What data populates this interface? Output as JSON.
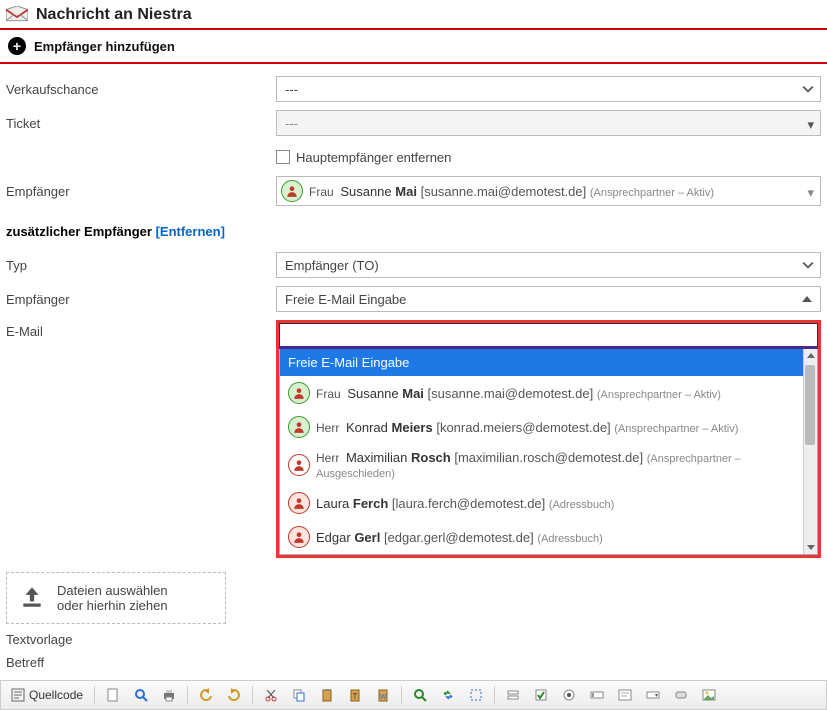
{
  "header": {
    "title": "Nachricht an Niestra"
  },
  "addbar": {
    "label": "Empfänger hinzufügen"
  },
  "labels": {
    "opportunity": "Verkaufschance",
    "ticket": "Ticket",
    "remove_main": "Hauptempfänger entfernen",
    "recipient": "Empfänger",
    "additional": "zusätzlicher Empfänger",
    "remove_link": "[Entfernen]",
    "type": "Typ",
    "recipient2": "Empfänger",
    "email": "E-Mail",
    "template": "Textvorlage",
    "subject": "Betreff"
  },
  "selects": {
    "opportunity": "---",
    "ticket": "---",
    "type": "Empfänger (TO)",
    "freemail": "Freie E-Mail Eingabe"
  },
  "main_recipient": {
    "salutation": "Frau",
    "first": "Susanne",
    "last": "Mai",
    "email": "susanne.mai@demotest.de",
    "meta": "(Ansprechpartner – Aktiv)",
    "icon": "green"
  },
  "email_input": "",
  "dropdown": {
    "selected_label": "Freie E-Mail Eingabe",
    "items": [
      {
        "icon": "green",
        "salutation": "Frau",
        "first": "Susanne",
        "last": "Mai",
        "email": "susanne.mai@demotest.de",
        "meta": "(Ansprechpartner – Aktiv)"
      },
      {
        "icon": "green",
        "salutation": "Herr",
        "first": "Konrad",
        "last": "Meiers",
        "email": "konrad.meiers@demotest.de",
        "meta": "(Ansprechpartner – Aktiv)"
      },
      {
        "icon": "white",
        "salutation": "Herr",
        "first": "Maximilian",
        "last": "Rosch",
        "email": "maximilian.rosch@demotest.de",
        "meta": "(Ansprechpartner – Ausgeschieden)"
      },
      {
        "icon": "red",
        "salutation": "",
        "first": "Laura",
        "last": "Ferch",
        "email": "laura.ferch@demotest.de",
        "meta": "(Adressbuch)"
      },
      {
        "icon": "red",
        "salutation": "",
        "first": "Edgar",
        "last": "Gerl",
        "email": "edgar.gerl@demotest.de",
        "meta": "(Adressbuch)"
      }
    ]
  },
  "filedrop": {
    "line1": "Dateien auswählen",
    "line2": "oder hierhin ziehen"
  },
  "toolbar": {
    "source": "Quellcode"
  },
  "colors": {
    "header_rule": "#c00",
    "dropdown_highlight": "#1e78e6",
    "combo_outline": "#e33"
  }
}
